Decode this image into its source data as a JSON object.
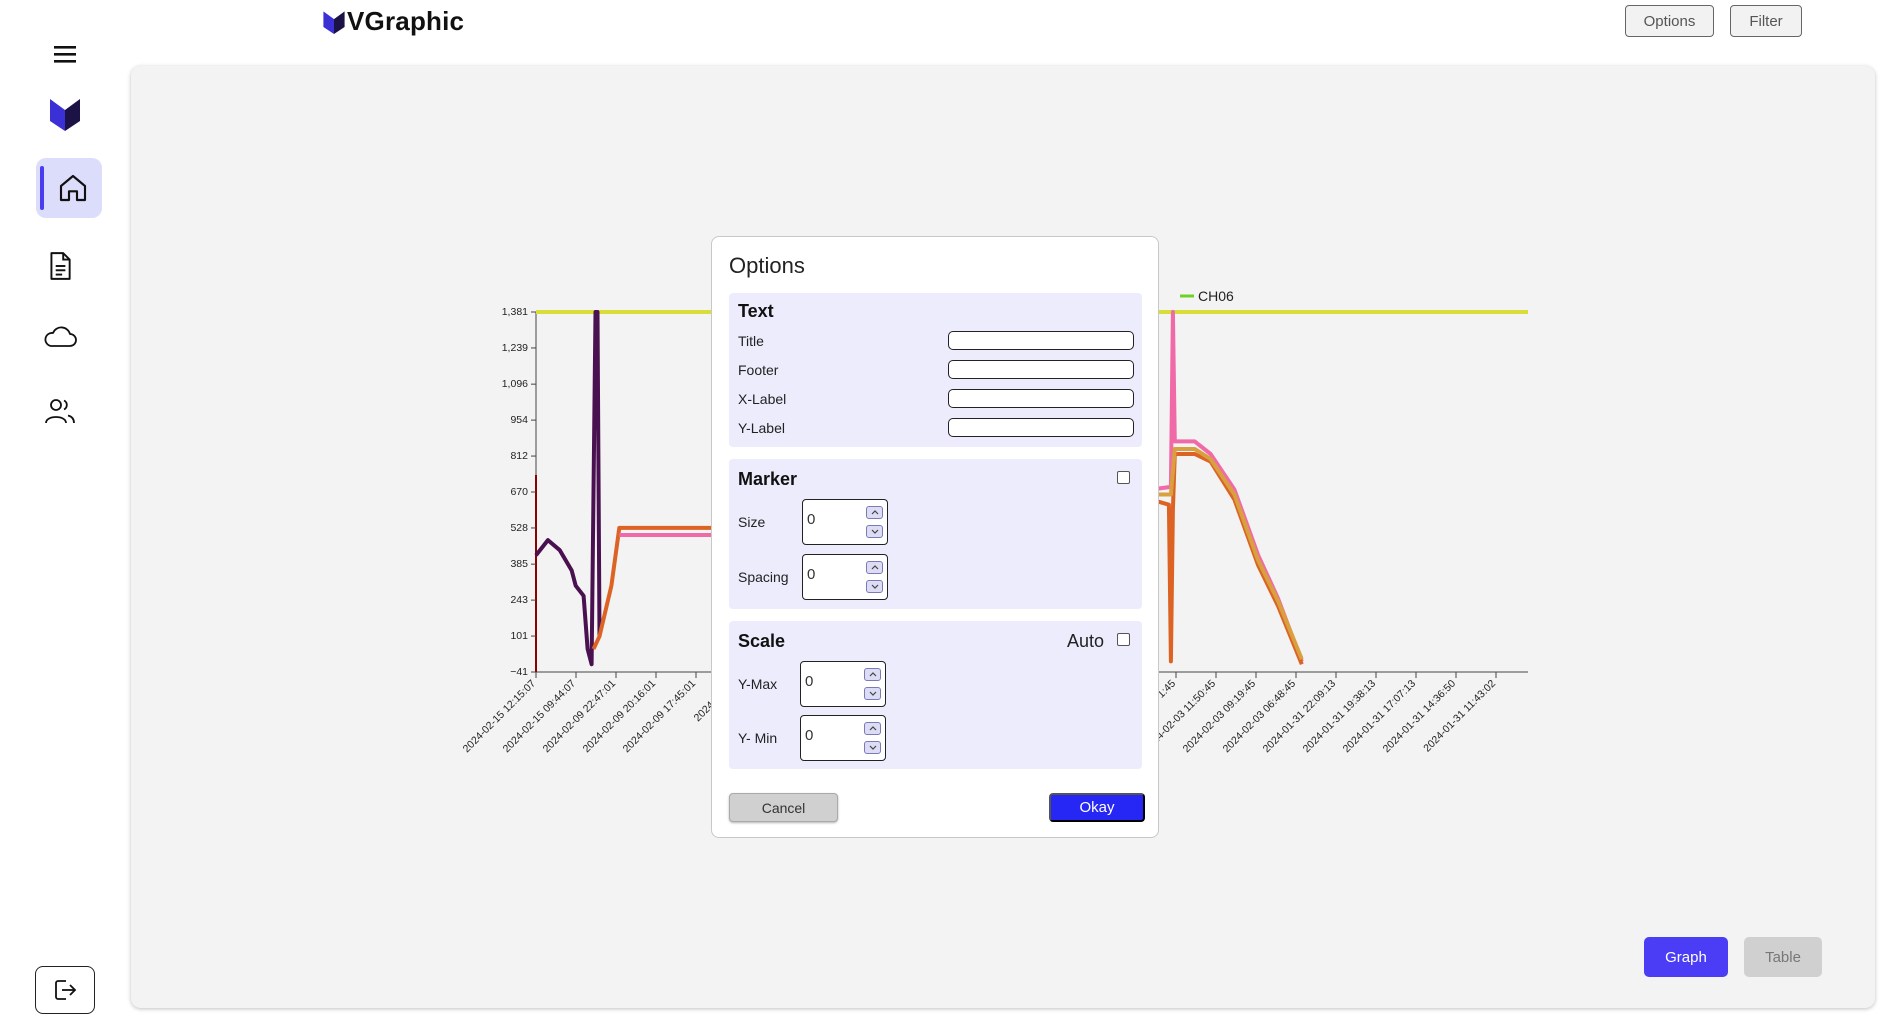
{
  "brand": {
    "name": "VGraphic"
  },
  "header": {
    "options_label": "Options",
    "filter_label": "Filter"
  },
  "sidebar": {
    "items": [
      {
        "icon": "menu-icon"
      },
      {
        "icon": "logo-icon"
      },
      {
        "icon": "home-icon",
        "active": true
      },
      {
        "icon": "document-icon"
      },
      {
        "icon": "cloud-icon"
      },
      {
        "icon": "users-icon"
      }
    ],
    "logout_icon": "logout-icon"
  },
  "view_toggle": {
    "graph_label": "Graph",
    "table_label": "Table",
    "active": "Graph"
  },
  "modal": {
    "title": "Options",
    "text_section": {
      "heading": "Text",
      "fields": [
        {
          "label": "Title",
          "value": ""
        },
        {
          "label": "Footer",
          "value": ""
        },
        {
          "label": "X-Label",
          "value": ""
        },
        {
          "label": "Y-Label",
          "value": ""
        }
      ]
    },
    "marker_section": {
      "heading": "Marker",
      "enabled": false,
      "size_label": "Size",
      "size_value": "0",
      "spacing_label": "Spacing",
      "spacing_value": "0"
    },
    "scale_section": {
      "heading": "Scale",
      "auto_label": "Auto",
      "auto": false,
      "ymax_label": "Y-Max",
      "ymax_value": "0",
      "ymin_label": "Y- Min",
      "ymin_value": "0"
    },
    "cancel_label": "Cancel",
    "okay_label": "Okay"
  },
  "chart_data": {
    "type": "line",
    "title": "",
    "xlabel": "",
    "ylabel": "",
    "ylim": [
      -41,
      1381
    ],
    "y_ticks": [
      -41,
      101,
      243,
      385,
      528,
      670,
      812,
      954,
      1096,
      1239,
      1381
    ],
    "y_tick_labels": [
      "−41",
      "101",
      "243",
      "385",
      "528",
      "670",
      "812",
      "954",
      "1,096",
      "1,239",
      "1,381"
    ],
    "x_tick_labels_left": [
      "2024-02-15 12:15:07",
      "2024-02-15 09:44:07",
      "2024-02-09 22:47:01",
      "2024-02-09 20:16:01",
      "2024-02-09 17:45:01",
      "2024-02-09"
    ],
    "x_tick_labels_right": [
      "1:45",
      "2024-02-03 11:50:45",
      "2024-02-03 09:19:45",
      "2024-02-03 06:48:45",
      "2024-01-31 22:09:13",
      "2024-01-31 19:38:13",
      "2024-01-31 17:07:13",
      "2024-01-31 14:36:50",
      "2024-01-31 11:43:02"
    ],
    "legend": [
      {
        "name": "CH06",
        "color": "#6fd02a"
      }
    ],
    "colors": {
      "yellow": "#d9dd3a",
      "purple": "#4a1150",
      "pink": "#f06aa8",
      "orange": "#dd6324",
      "gold": "#d9a040",
      "axis": "#8b0000"
    },
    "series": [
      {
        "color": "#d9dd3a",
        "points": [
          [
            0,
            1381
          ],
          [
            5.2,
            1381
          ]
        ]
      },
      {
        "color": "#d9dd3a",
        "points": [
          [
            11.8,
            1381
          ],
          [
            25,
            1381
          ]
        ]
      },
      {
        "color": "#4a1150",
        "points": [
          [
            0,
            420
          ],
          [
            0.3,
            480
          ],
          [
            0.6,
            440
          ],
          [
            0.9,
            360
          ],
          [
            1.0,
            300
          ],
          [
            1.2,
            260
          ],
          [
            1.3,
            50
          ],
          [
            1.4,
            -10
          ],
          [
            1.5,
            1381
          ],
          [
            1.55,
            1381
          ],
          [
            1.6,
            100
          ]
        ]
      },
      {
        "color": "#dd6324",
        "points": [
          [
            1.45,
            50
          ],
          [
            1.6,
            100
          ],
          [
            1.9,
            300
          ],
          [
            2.1,
            528
          ],
          [
            3.6,
            528
          ],
          [
            5.2,
            528
          ]
        ]
      },
      {
        "color": "#f06aa8",
        "points": [
          [
            2.1,
            500
          ],
          [
            5.2,
            500
          ]
        ]
      },
      {
        "color": "#4a1150",
        "points": [
          [
            11.8,
            860
          ],
          [
            12.2,
            860
          ],
          [
            12.5,
            800
          ],
          [
            12.8,
            720
          ],
          [
            13.3,
            560
          ],
          [
            13.7,
            380
          ],
          [
            14.0,
            250
          ],
          [
            14.3,
            100
          ],
          [
            14.5,
            40
          ],
          [
            14.55,
            1381
          ],
          [
            14.6,
            1381
          ],
          [
            14.65,
            40
          ]
        ]
      },
      {
        "color": "#d9a040",
        "points": [
          [
            11.8,
            820
          ],
          [
            12.2,
            820
          ],
          [
            12.5,
            780
          ],
          [
            12.8,
            700
          ],
          [
            13.3,
            540
          ],
          [
            13.7,
            360
          ],
          [
            14.0,
            230
          ],
          [
            14.3,
            80
          ],
          [
            14.5,
            20
          ]
        ]
      },
      {
        "color": "#f06aa8",
        "points": [
          [
            11.8,
            830
          ],
          [
            12.3,
            830
          ],
          [
            12.8,
            720
          ],
          [
            13.4,
            520
          ],
          [
            14.0,
            200
          ],
          [
            14.3,
            90
          ],
          [
            14.6,
            -20
          ],
          [
            14.8,
            -20
          ],
          [
            14.85,
            1381
          ],
          [
            14.9,
            1381
          ],
          [
            14.95,
            650
          ],
          [
            15.5,
            680
          ],
          [
            16.0,
            690
          ],
          [
            16.05,
            1381
          ],
          [
            16.1,
            870
          ],
          [
            16.6,
            870
          ],
          [
            17.0,
            820
          ],
          [
            17.6,
            680
          ],
          [
            18.2,
            420
          ],
          [
            18.7,
            250
          ],
          [
            19.3,
            0
          ]
        ]
      },
      {
        "color": "#dd6324",
        "points": [
          [
            14.6,
            -30
          ],
          [
            14.75,
            -30
          ],
          [
            14.85,
            1381
          ],
          [
            14.9,
            1381
          ],
          [
            14.95,
            620
          ],
          [
            15.5,
            640
          ],
          [
            15.95,
            620
          ],
          [
            16.0,
            1
          ],
          [
            16.05,
            600
          ],
          [
            16.1,
            820
          ],
          [
            16.6,
            820
          ],
          [
            17.0,
            790
          ],
          [
            17.6,
            640
          ],
          [
            18.2,
            380
          ],
          [
            18.7,
            220
          ],
          [
            19.3,
            -10
          ]
        ]
      },
      {
        "color": "#d9a040",
        "points": [
          [
            14.95,
            660
          ],
          [
            15.5,
            660
          ],
          [
            16.0,
            660
          ],
          [
            16.1,
            840
          ],
          [
            16.6,
            840
          ],
          [
            17.0,
            800
          ],
          [
            17.6,
            660
          ],
          [
            18.2,
            400
          ],
          [
            18.7,
            240
          ],
          [
            19.3,
            10
          ]
        ]
      }
    ]
  }
}
